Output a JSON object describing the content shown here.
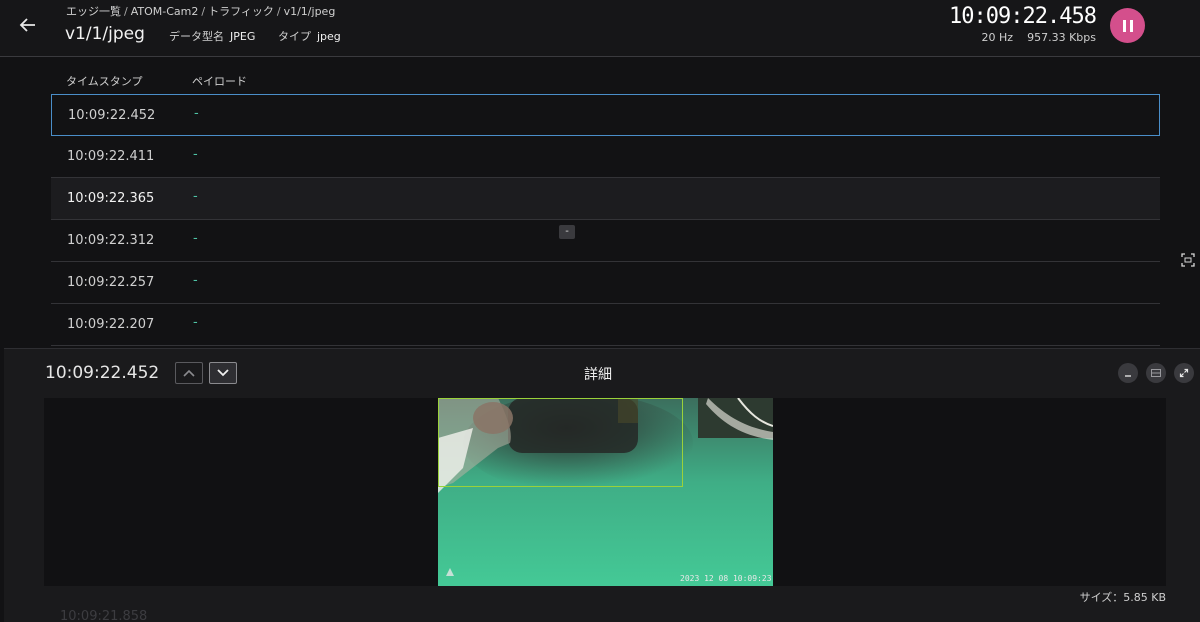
{
  "header": {
    "breadcrumb": [
      "エッジ一覧",
      "ATOM-Cam2",
      "トラフィック",
      "v1/1/jpeg"
    ],
    "breadcrumb_sep": "/",
    "topic": "v1/1/jpeg",
    "datatype_label": "データ型名",
    "datatype_value": "JPEG",
    "type_label": "タイプ",
    "type_value": "jpeg",
    "clock": "10:09:22.458",
    "rate_hz": "20 Hz",
    "rate_kbps": "957.33 Kbps",
    "back_icon": "arrow-left-icon",
    "pause_icon": "pause-icon",
    "accent": "#d44f8c"
  },
  "table": {
    "columns": [
      "タイムスタンプ",
      "ペイロード"
    ],
    "rows": [
      {
        "timestamp": "10:09:22.452",
        "payload": "-"
      },
      {
        "timestamp": "10:09:22.411",
        "payload": "-"
      },
      {
        "timestamp": "10:09:22.365",
        "payload": "-"
      },
      {
        "timestamp": "10:09:22.312",
        "payload": "-"
      },
      {
        "timestamp": "10:09:22.257",
        "payload": "-"
      },
      {
        "timestamp": "10:09:22.207",
        "payload": "-"
      }
    ],
    "hint": "-"
  },
  "detail": {
    "timestamp": "10:09:22.452",
    "title": "詳細",
    "size_label": "サイズ：5.85 KB",
    "image_timestamp": "2023 12 08 10:09:23",
    "peek_row": "10:09:21.858"
  }
}
